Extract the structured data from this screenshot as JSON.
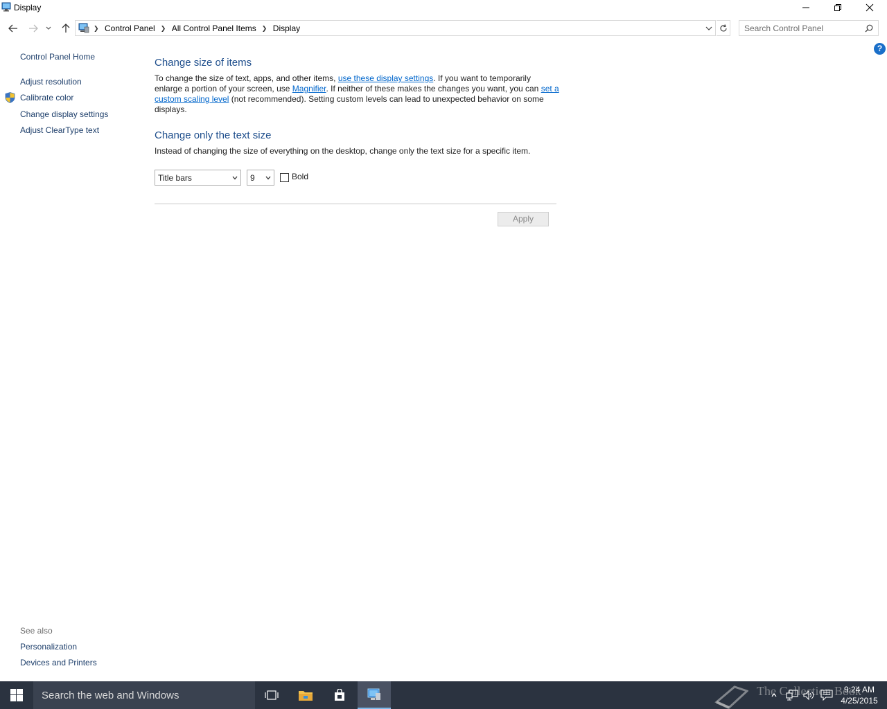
{
  "window": {
    "title": "Display",
    "icon": "display-control-panel-icon"
  },
  "nav": {
    "breadcrumbs": [
      "Control Panel",
      "All Control Panel Items",
      "Display"
    ],
    "search_placeholder": "Search Control Panel"
  },
  "help": {
    "label": "?"
  },
  "sidebar": {
    "home": "Control Panel Home",
    "items": [
      {
        "label": "Adjust resolution"
      },
      {
        "label": "Calibrate color",
        "icon": "uac-shield-icon"
      },
      {
        "label": "Change display settings"
      },
      {
        "label": "Adjust ClearType text"
      }
    ],
    "see_also_title": "See also",
    "see_also": [
      {
        "label": "Personalization"
      },
      {
        "label": "Devices and Printers"
      }
    ]
  },
  "main": {
    "section1": {
      "heading": "Change size of items",
      "text_1": "To change the size of text, apps, and other items, ",
      "link_1": "use these display settings",
      "text_2": ".  If you want to temporarily enlarge a portion of your screen, use ",
      "link_2": "Magnifier",
      "text_3": ".  If neither of these makes the changes you want, you can ",
      "link_3": "set a custom scaling level",
      "text_4": " (not recommended).  Setting custom levels can lead to unexpected behavior on some displays."
    },
    "section2": {
      "heading": "Change only the text size",
      "description": "Instead of changing the size of everything on the desktop, change only the text size for a specific item.",
      "item_select": "Title bars",
      "size_select": "9",
      "bold_label": "Bold",
      "bold_checked": false
    },
    "apply_label": "Apply"
  },
  "taskbar": {
    "search_placeholder": "Search the web and Windows",
    "time": "9:24 AM",
    "date": "4/25/2015",
    "watermark": "The Collection Book"
  },
  "colors": {
    "heading": "#1e4e8c",
    "link": "#0066cc",
    "sidebar_link": "#1e3f6b",
    "taskbar": "#2b3340"
  }
}
